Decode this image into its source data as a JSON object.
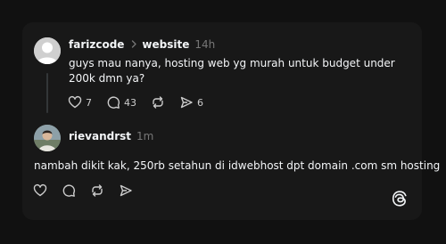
{
  "post": {
    "username": "farizcode",
    "community": "website",
    "time": "14h",
    "text": "guys mau nanya, hosting web yg murah untuk budget under 200k dmn ya?",
    "likes": "7",
    "replies": "43",
    "reposts": "",
    "shares": "6"
  },
  "reply": {
    "username": "rievandrst",
    "time": "1m",
    "text": "nambah dikit kak, 250rb setahun di idwebhost dpt domain .com sm hosting"
  },
  "icons": {
    "like": "heart-icon",
    "reply": "comment-icon",
    "repost": "repost-icon",
    "share": "send-icon",
    "logo": "threads-logo-icon",
    "separator": "chevron-right-icon"
  },
  "colors": {
    "background": "#111111",
    "card": "#181818",
    "text": "#f3f5f7",
    "muted": "#777777"
  }
}
